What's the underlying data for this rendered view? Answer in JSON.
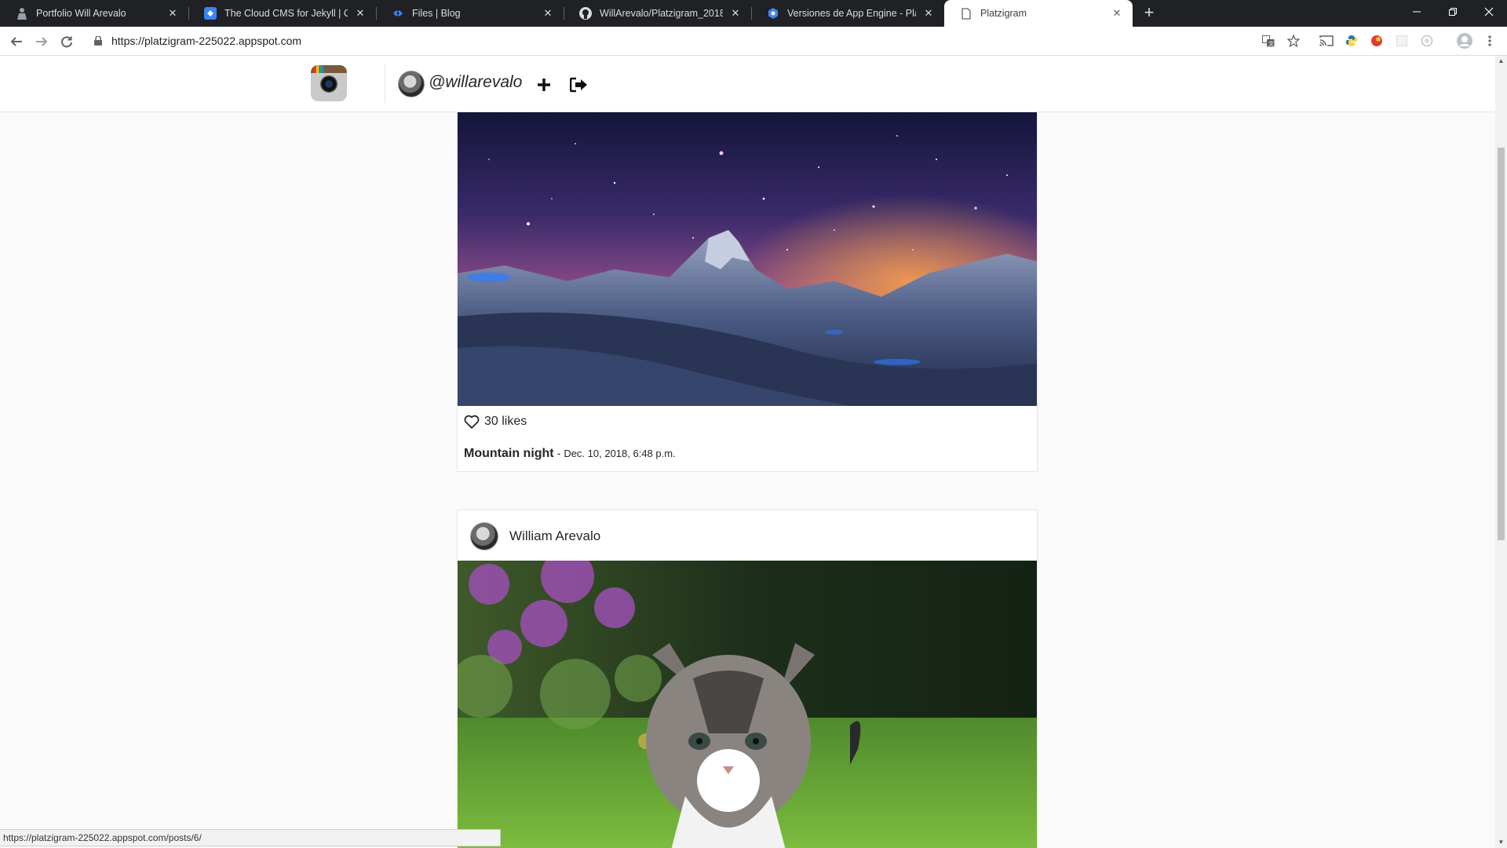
{
  "browser": {
    "tabs": [
      {
        "title": "Portfolio Will Arevalo",
        "icon": "person-icon"
      },
      {
        "title": "The Cloud CMS for Jekyll | Cloud",
        "icon": "cloudcannon-icon"
      },
      {
        "title": "Files | Blog",
        "icon": "cloudcannon-icon"
      },
      {
        "title": "WillArevalo/Platzigram_2018_Dja",
        "icon": "github-icon"
      },
      {
        "title": "Versiones de App Engine - Platzi",
        "icon": "app-engine-icon"
      },
      {
        "title": "Platzigram",
        "icon": "page-icon",
        "active": true
      }
    ],
    "url": "https://platzigram-225022.appspot.com",
    "status_url": "https://platzigram-225022.appspot.com/posts/6/"
  },
  "app": {
    "username": "@willarevalo"
  },
  "posts": [
    {
      "likes": "30 likes",
      "title": "Mountain night",
      "separator": "-",
      "date": "Dec. 10, 2018, 6:48 p.m."
    },
    {
      "author": "William Arevalo"
    }
  ],
  "colors": {
    "chrome_dark": "#202124",
    "page_bg": "#fafafa",
    "card_border": "#e6e6e6",
    "text": "#262626"
  }
}
